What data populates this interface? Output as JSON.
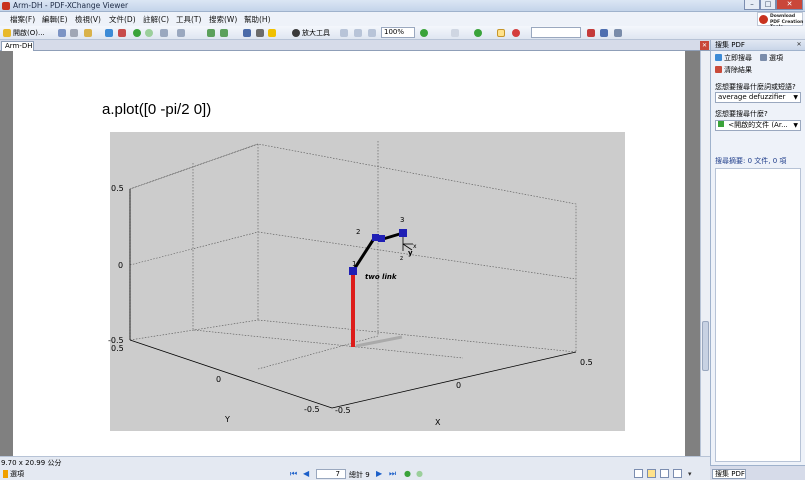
{
  "window": {
    "title": "Arm-DH - PDF-XChange Viewer",
    "minimize": "–",
    "maximize": "□",
    "close": "✕"
  },
  "promo": {
    "label": "Download PDF Creation Tools"
  },
  "menu": [
    "檔案(F)",
    "編輯(E)",
    "檢視(V)",
    "文件(D)",
    "註解(C)",
    "工具(T)",
    "搜索(W)",
    "幫助(H)"
  ],
  "toolbar": {
    "open_label": "開啟(O)...",
    "zoom_tool_label": "放大工具",
    "zoom_value": "100%"
  },
  "tab": {
    "label": "Arm-DH",
    "close": "✕"
  },
  "document": {
    "plot_title": "a.plot([0 -pi/2 0])",
    "z_ticks": [
      "0.5",
      "0",
      "-0.5"
    ],
    "y_ticks": [
      "0.5",
      "0",
      "-0.5"
    ],
    "x_ticks": [
      "-0.5",
      "0",
      "0.5"
    ],
    "y_axis_label": "Y",
    "x_axis_label": "X",
    "robot_label": "two link",
    "joint_labels": [
      "1",
      "2",
      "3"
    ],
    "frame_labels": {
      "x": "x",
      "y": "y",
      "z": "z"
    }
  },
  "side_panel": {
    "header": "搜集 PDF",
    "search_now": "立即搜尋",
    "options": "選項",
    "clear_results": "清除結果",
    "query_label": "您想要搜尋什麼詞或短語?",
    "query_value": "average defuzzifier",
    "scope_label": "您想要搜尋什麼?",
    "scope_value": "<開啟的文件 (Ar...",
    "summary": "搜尋摘要: 0 文件, 0 項",
    "tab_label": "搜集 PDF"
  },
  "status": {
    "page_size": "9.70 x 20.99 公分",
    "options": "選項",
    "page_number": "7",
    "total_pages": "總計 9"
  },
  "colors": {
    "link_red": "#dd1c1a",
    "joint_blue": "#1f1fb5",
    "figure_bg": "#cccccc",
    "shadow_gray": "#aaaaaa"
  }
}
